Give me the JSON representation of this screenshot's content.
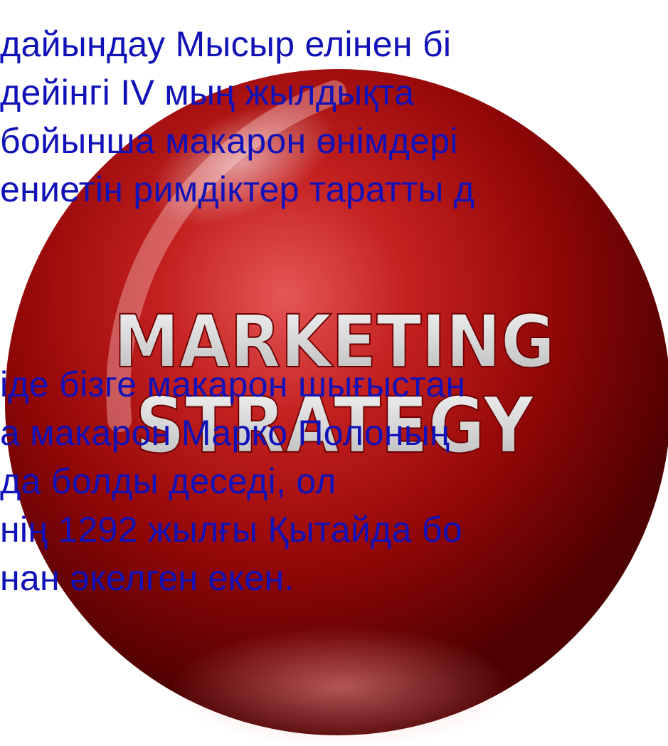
{
  "colors": {
    "text": "#1111b8",
    "ball_dark": "#5a0000",
    "ball_mid": "#a80c0c",
    "ball_light": "#e25050",
    "logo_text": "#e8e8e8"
  },
  "logo": {
    "icon": "marketing-strategy-ball",
    "line1": "MARKETING",
    "line2": "STRATEGY"
  },
  "paragraphs": [
    {
      "lines": [
        "дайындау Мысыр елінен бі",
        "дейінгі IV мың жылдықта",
        "бойынша макарон өнімдері",
        "ениетін римдіктер таратты д"
      ]
    },
    {
      "lines": [
        "іде бізге макарон шығыстан",
        "а макарон Марко Полоның",
        "да болды деседі, ол",
        "нің 1292 жылғы Қытайда бо",
        "нан әкелген екен."
      ]
    }
  ]
}
